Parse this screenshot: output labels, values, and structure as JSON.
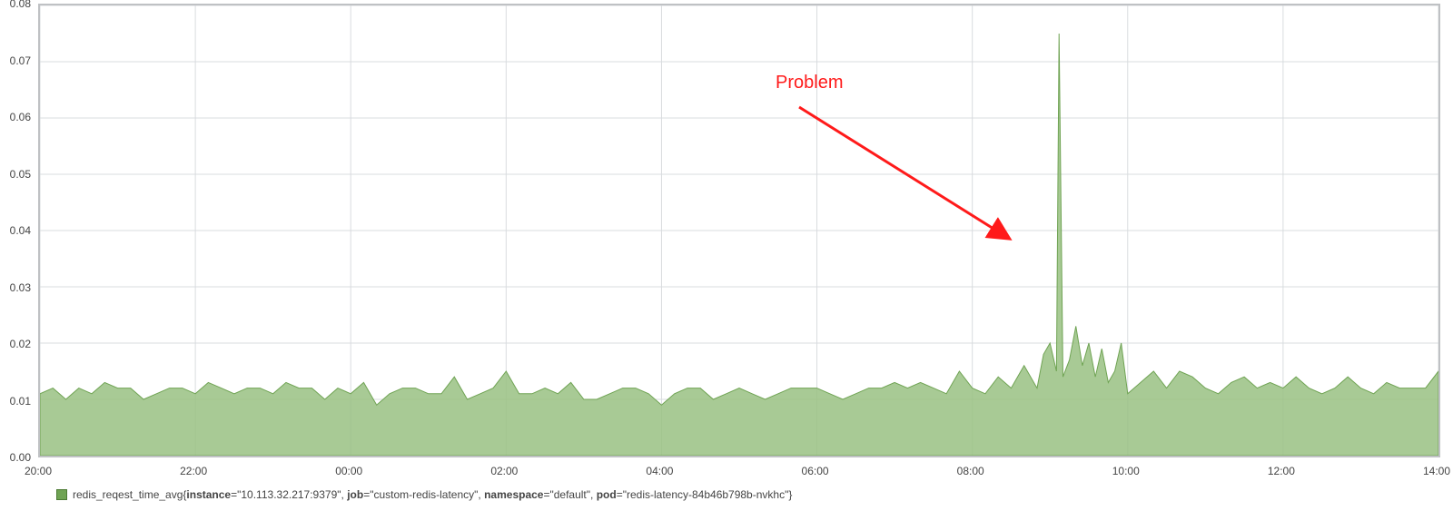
{
  "chart_data": {
    "type": "area",
    "title": "",
    "xlabel": "",
    "ylabel": "",
    "ylim": [
      0.0,
      0.08
    ],
    "y_ticks": [
      0.0,
      0.01,
      0.02,
      0.03,
      0.04,
      0.05,
      0.06,
      0.07,
      0.08
    ],
    "x_ticks": [
      "20:00",
      "22:00",
      "00:00",
      "02:00",
      "04:00",
      "06:00",
      "08:00",
      "10:00",
      "12:00",
      "14:00"
    ],
    "x_range_minutes": [
      0,
      1080
    ],
    "series": [
      {
        "name": "redis_reqest_time_avg",
        "color": "#6fa353",
        "x_minutes": [
          0,
          10,
          20,
          30,
          40,
          50,
          60,
          70,
          80,
          90,
          100,
          110,
          120,
          130,
          140,
          150,
          160,
          170,
          180,
          190,
          200,
          210,
          220,
          230,
          240,
          250,
          260,
          270,
          280,
          290,
          300,
          310,
          320,
          330,
          340,
          350,
          360,
          370,
          380,
          390,
          400,
          410,
          420,
          430,
          440,
          450,
          460,
          470,
          480,
          490,
          500,
          510,
          520,
          530,
          540,
          550,
          560,
          570,
          580,
          590,
          600,
          610,
          620,
          630,
          640,
          650,
          660,
          670,
          680,
          690,
          700,
          710,
          720,
          730,
          740,
          750,
          760,
          770,
          775,
          780,
          785,
          787,
          790,
          795,
          800,
          805,
          810,
          815,
          820,
          825,
          830,
          835,
          840,
          850,
          860,
          870,
          880,
          890,
          900,
          910,
          920,
          930,
          940,
          950,
          960,
          970,
          980,
          990,
          1000,
          1010,
          1020,
          1030,
          1040,
          1050,
          1060,
          1070,
          1080
        ],
        "y": [
          0.011,
          0.012,
          0.01,
          0.012,
          0.011,
          0.013,
          0.012,
          0.012,
          0.01,
          0.011,
          0.012,
          0.012,
          0.011,
          0.013,
          0.012,
          0.011,
          0.012,
          0.012,
          0.011,
          0.013,
          0.012,
          0.012,
          0.01,
          0.012,
          0.011,
          0.013,
          0.009,
          0.011,
          0.012,
          0.012,
          0.011,
          0.011,
          0.014,
          0.01,
          0.011,
          0.012,
          0.015,
          0.011,
          0.011,
          0.012,
          0.011,
          0.013,
          0.01,
          0.01,
          0.011,
          0.012,
          0.012,
          0.011,
          0.009,
          0.011,
          0.012,
          0.012,
          0.01,
          0.011,
          0.012,
          0.011,
          0.01,
          0.011,
          0.012,
          0.012,
          0.012,
          0.011,
          0.01,
          0.011,
          0.012,
          0.012,
          0.013,
          0.012,
          0.013,
          0.012,
          0.011,
          0.015,
          0.012,
          0.011,
          0.014,
          0.012,
          0.016,
          0.012,
          0.018,
          0.02,
          0.015,
          0.075,
          0.014,
          0.017,
          0.023,
          0.016,
          0.02,
          0.014,
          0.019,
          0.013,
          0.015,
          0.02,
          0.011,
          0.013,
          0.015,
          0.012,
          0.015,
          0.014,
          0.012,
          0.011,
          0.013,
          0.014,
          0.012,
          0.013,
          0.012,
          0.014,
          0.012,
          0.011,
          0.012,
          0.014,
          0.012,
          0.011,
          0.013,
          0.012,
          0.012,
          0.012,
          0.015
        ]
      }
    ],
    "annotation": {
      "text": "Problem",
      "target_x_minutes": 787,
      "target_y": 0.075
    }
  },
  "y_tick_labels": [
    "0.00",
    "0.01",
    "0.02",
    "0.03",
    "0.04",
    "0.05",
    "0.06",
    "0.07",
    "0.08"
  ],
  "x_tick_labels": [
    "20:00",
    "22:00",
    "00:00",
    "02:00",
    "04:00",
    "06:00",
    "08:00",
    "10:00",
    "12:00",
    "14:00"
  ],
  "annotation": {
    "text": "Problem"
  },
  "legend": {
    "metric": "redis_reqest_time_avg",
    "labels": {
      "instance_key": "instance",
      "instance_val": "=\"10.113.32.217:9379\", ",
      "job_key": "job",
      "job_val": "=\"custom-redis-latency\", ",
      "namespace_key": "namespace",
      "namespace_val": "=\"default\", ",
      "pod_key": "pod",
      "pod_val": "=\"redis-latency-84b46b798b-nvkhc\"}"
    },
    "open_brace": "{"
  }
}
